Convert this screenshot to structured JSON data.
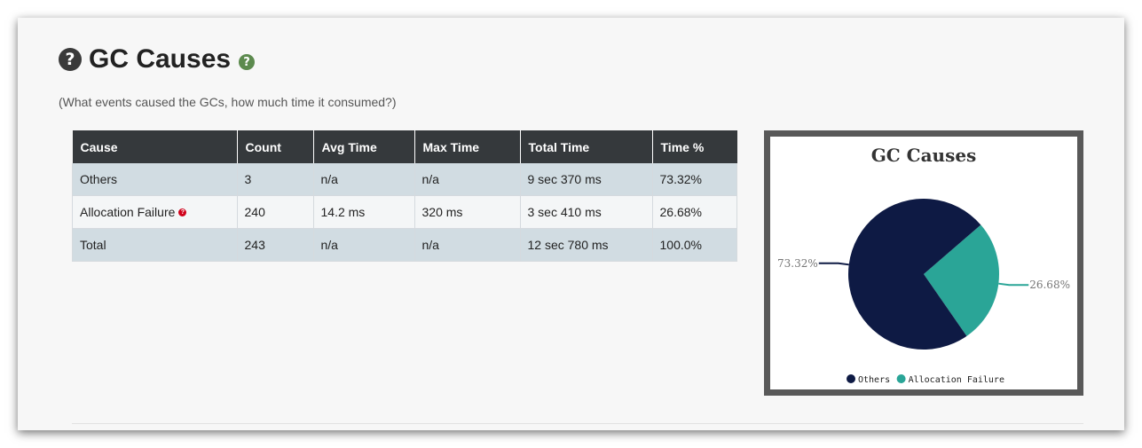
{
  "section": {
    "help_icon": "question-circle-icon",
    "title": "GC Causes",
    "info_icon": "question-circle-icon",
    "subtitle": "(What events caused the GCs, how much time it consumed?)"
  },
  "table": {
    "headers": [
      "Cause",
      "Count",
      "Avg Time",
      "Max Time",
      "Total Time",
      "Time %"
    ],
    "rows": [
      [
        "Others",
        "3",
        "n/a",
        "n/a",
        "9 sec 370 ms",
        "73.32%"
      ],
      [
        "Allocation Failure",
        "240",
        "14.2 ms",
        "320 ms",
        "3 sec 410 ms",
        "26.68%"
      ],
      [
        "Total",
        "243",
        "n/a",
        "n/a",
        "12 sec 780 ms",
        "100.0%"
      ]
    ]
  },
  "colors": {
    "others": "#0e1a44",
    "allocation_failure": "#2aa597",
    "header_bg": "#35393c",
    "help_green": "#5c8a4e",
    "help_red": "#d0021b"
  },
  "chart_data": {
    "type": "pie",
    "title": "GC Causes",
    "labels": [
      "Others",
      "Allocation Failure"
    ],
    "values": [
      73.32,
      26.68
    ],
    "data_labels": [
      "73.32%",
      "26.68%"
    ],
    "colors": [
      "#0e1a44",
      "#2aa597"
    ],
    "legend": "bottom"
  }
}
